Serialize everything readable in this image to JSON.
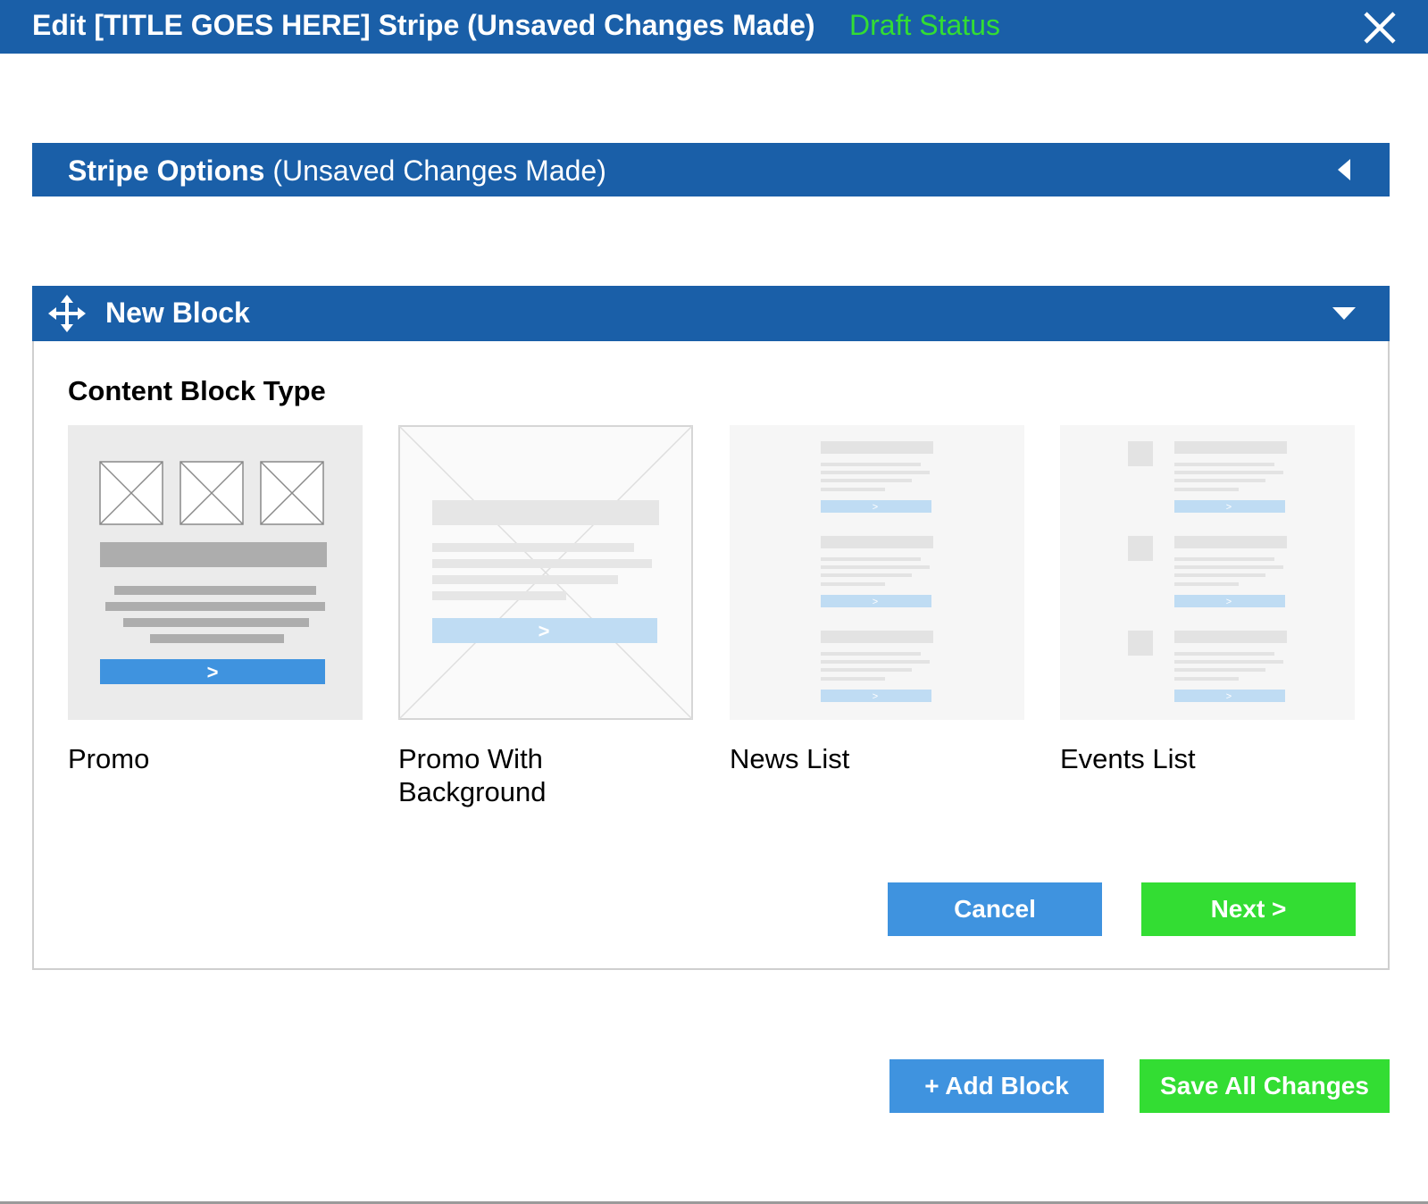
{
  "header": {
    "title": "Edit [TITLE GOES HERE] Stripe (Unsaved Changes Made)",
    "status": "Draft Status",
    "close_icon": "close-icon"
  },
  "stripe_options": {
    "title": "Stripe Options",
    "note": "(Unsaved Changes Made)",
    "toggle_icon": "caret-left-icon"
  },
  "new_block": {
    "title": "New Block",
    "move_icon": "move-icon",
    "toggle_icon": "caret-down-icon",
    "section_title": "Content Block Type",
    "types": [
      {
        "label": "Promo"
      },
      {
        "label": "Promo With Background"
      },
      {
        "label": "News List"
      },
      {
        "label": "Events List"
      }
    ],
    "cancel_label": "Cancel",
    "next_label": "Next >"
  },
  "footer": {
    "add_block_label": "+ Add Block",
    "save_label": "Save All Changes"
  },
  "colors": {
    "header_blue": "#1a5fa8",
    "button_blue": "#3f93df",
    "button_green": "#33dd33",
    "status_green": "#33dd33"
  }
}
